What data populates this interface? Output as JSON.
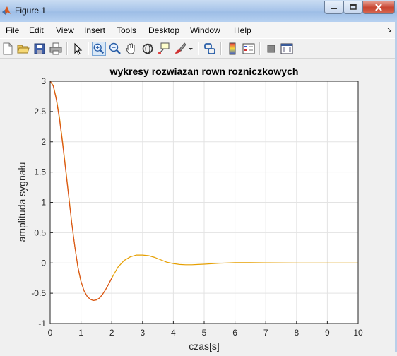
{
  "window": {
    "title": "Figure 1"
  },
  "menu": [
    "File",
    "Edit",
    "View",
    "Insert",
    "Tools",
    "Desktop",
    "Window",
    "Help"
  ],
  "toolbar": {
    "buttons": [
      "new-figure",
      "open-file",
      "save",
      "print",
      "edit-plot",
      "zoom-in",
      "zoom-out",
      "pan",
      "rotate-3d",
      "data-cursor",
      "brush",
      "link-plot",
      "insert-colorbar",
      "insert-legend",
      "hide-plot-tools",
      "show-plot-tools"
    ]
  },
  "chart_data": {
    "type": "line",
    "title": "wykresy rozwiazan rown rozniczkowych",
    "xlabel": "czas[s]",
    "ylabel": "amplituda sygnału",
    "xlim": [
      0,
      10
    ],
    "ylim": [
      -1,
      3
    ],
    "xticks": [
      "0",
      "1",
      "2",
      "3",
      "4",
      "5",
      "6",
      "7",
      "8",
      "9",
      "10"
    ],
    "yticks": [
      "3",
      "2.5",
      "2",
      "1.5",
      "1",
      "0.5",
      "0",
      "-0.5",
      "-1"
    ],
    "grid": true,
    "series": [
      {
        "color": "#e69f00",
        "x": [
          0,
          0.1,
          0.2,
          0.3,
          0.4,
          0.5,
          0.6,
          0.7,
          0.8,
          0.9,
          1.0,
          1.1,
          1.2,
          1.3,
          1.4,
          1.5,
          1.6,
          1.7,
          1.8,
          1.9,
          2.0,
          2.2,
          2.4,
          2.6,
          2.8,
          3.0,
          3.2,
          3.4,
          3.6,
          3.8,
          4.0,
          4.2,
          4.4,
          4.6,
          4.8,
          5.0,
          5.5,
          6.0,
          6.5,
          7.0,
          8.0,
          9.0,
          10.0
        ],
        "y": [
          3.0,
          2.93,
          2.72,
          2.41,
          2.02,
          1.58,
          1.12,
          0.67,
          0.27,
          -0.07,
          -0.31,
          -0.46,
          -0.55,
          -0.6,
          -0.62,
          -0.61,
          -0.58,
          -0.52,
          -0.44,
          -0.35,
          -0.25,
          -0.07,
          0.04,
          0.1,
          0.13,
          0.13,
          0.12,
          0.09,
          0.05,
          0.01,
          -0.01,
          -0.025,
          -0.03,
          -0.03,
          -0.025,
          -0.02,
          -0.005,
          0.004,
          0.005,
          0.002,
          0.0,
          0.0,
          0.0
        ]
      },
      {
        "color": "#d95319",
        "x": [
          0,
          0.1,
          0.2,
          0.3,
          0.4,
          0.5,
          0.6,
          0.7,
          0.8,
          0.9,
          1.0,
          1.1,
          1.2,
          1.3,
          1.4,
          1.5,
          1.6,
          1.7,
          1.8,
          1.9,
          2.0
        ],
        "y": [
          3.0,
          2.92,
          2.7,
          2.38,
          1.99,
          1.55,
          1.1,
          0.66,
          0.27,
          -0.06,
          -0.3,
          -0.46,
          -0.55,
          -0.6,
          -0.62,
          -0.61,
          -0.58,
          -0.52,
          -0.44,
          -0.35,
          -0.25
        ]
      }
    ]
  }
}
